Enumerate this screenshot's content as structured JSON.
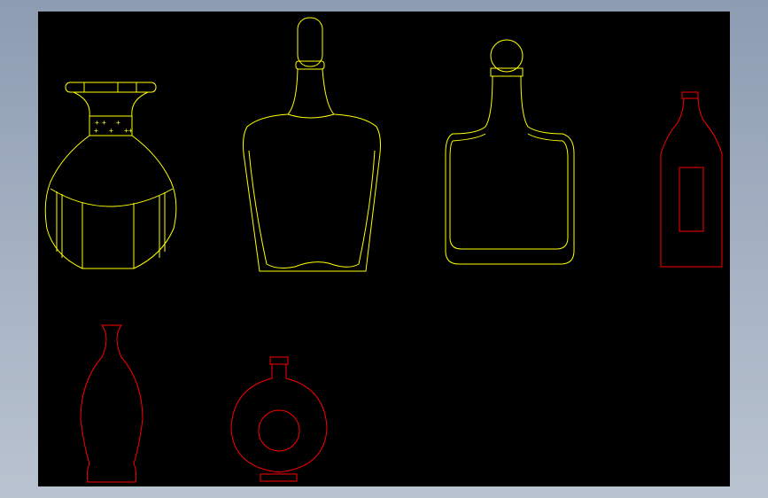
{
  "window": {
    "background_color": "#000000",
    "frame_gradient": [
      "#8d9cb2",
      "#b9c3d0"
    ]
  },
  "drawing": {
    "colors": {
      "primary_lines": "#ffff00",
      "secondary_lines": "#ff0000"
    },
    "objects": [
      {
        "name": "vase-bottle",
        "color": "yellow"
      },
      {
        "name": "decanter-bottle",
        "color": "yellow"
      },
      {
        "name": "square-stopper-bottle",
        "color": "yellow"
      },
      {
        "name": "tall-label-bottle",
        "color": "red"
      },
      {
        "name": "slim-curved-bottle",
        "color": "red"
      },
      {
        "name": "ring-flask-bottle",
        "color": "red"
      }
    ],
    "vase_marks": [
      "+",
      "+",
      "+",
      "+",
      "+",
      "+",
      "+"
    ]
  }
}
